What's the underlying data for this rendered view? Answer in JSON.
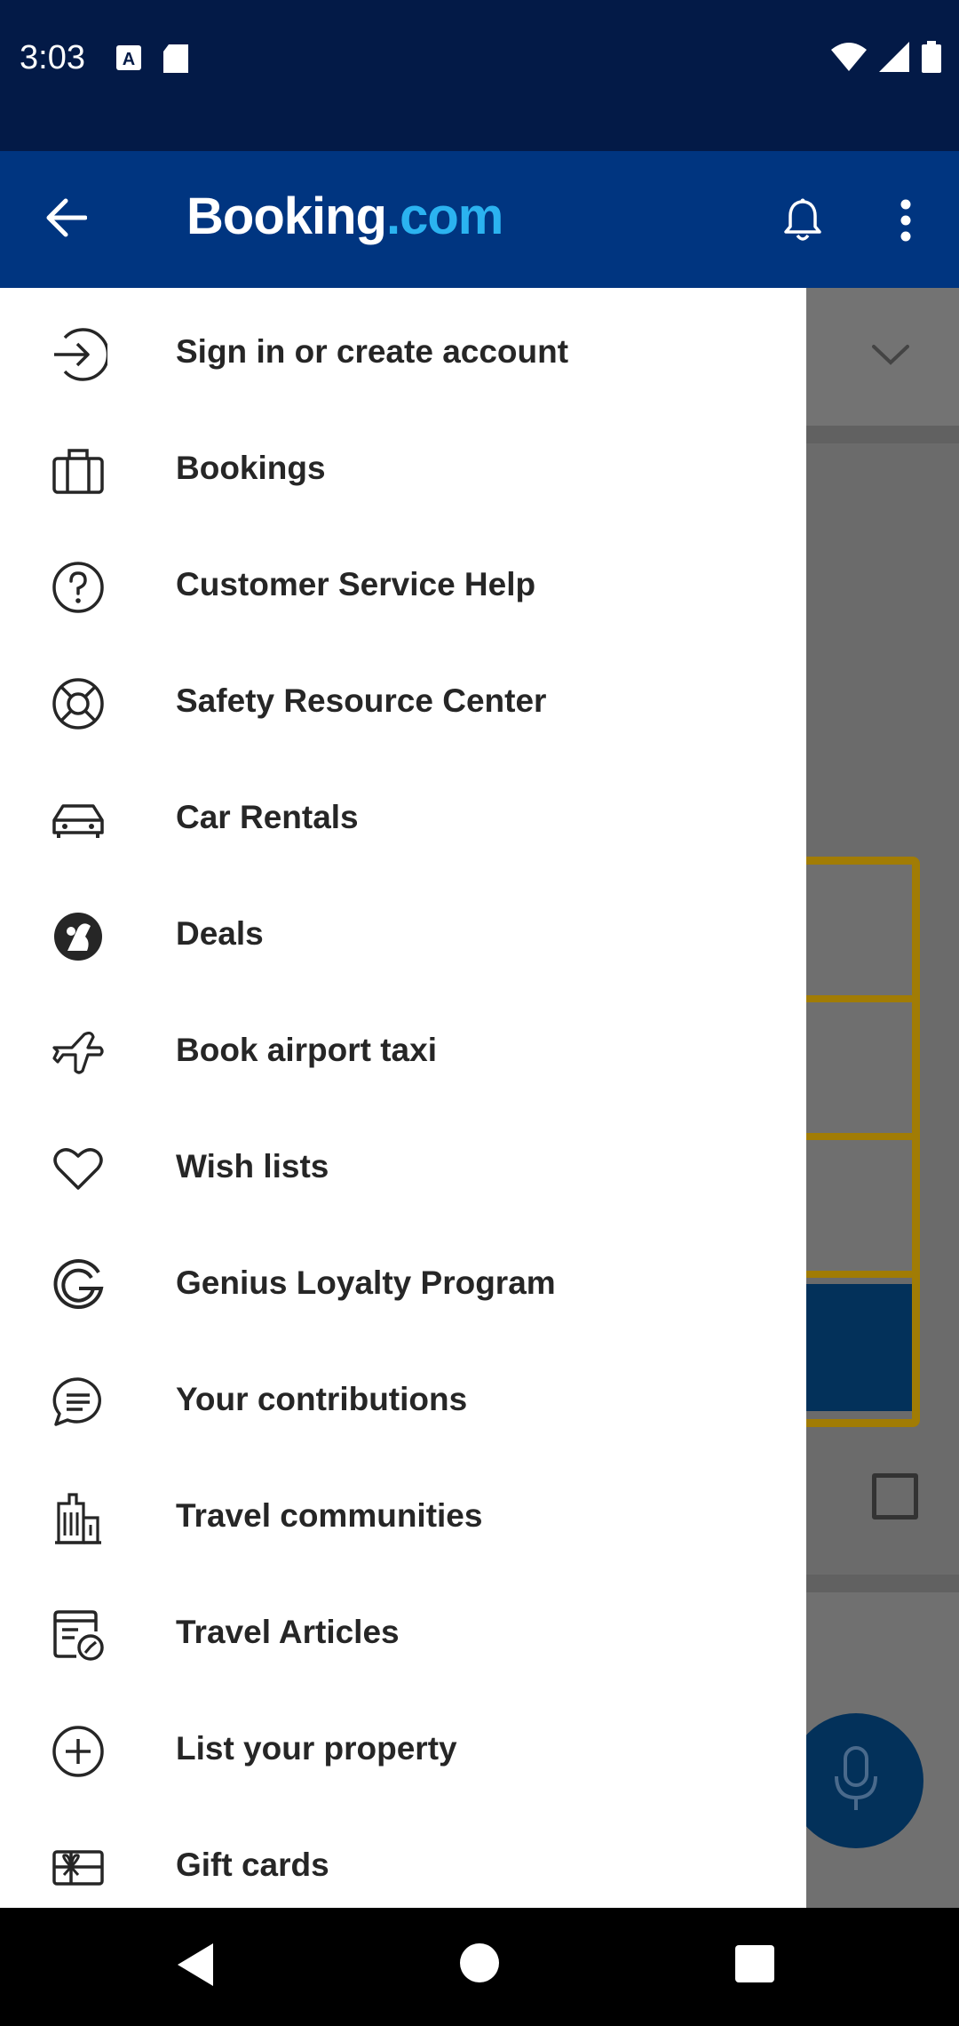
{
  "status_bar": {
    "time": "3:03",
    "icons": [
      "font-icon",
      "sd-card-icon",
      "wifi-icon",
      "signal-icon",
      "battery-icon"
    ]
  },
  "app_bar": {
    "brand_part1": "Booking",
    "brand_part2": ".com",
    "brand_color": "#2bb3f0",
    "background": "#003580",
    "icons": [
      "back-arrow-icon",
      "bell-icon",
      "more-vert-icon"
    ]
  },
  "menu": {
    "items": [
      {
        "label": "Sign in or create account",
        "icon": "sign-in-icon"
      },
      {
        "label": "Bookings",
        "icon": "briefcase-icon"
      },
      {
        "label": "Customer Service Help",
        "icon": "question-circle-icon"
      },
      {
        "label": "Safety Resource Center",
        "icon": "lifebuoy-icon"
      },
      {
        "label": "Car Rentals",
        "icon": "car-icon"
      },
      {
        "label": "Deals",
        "icon": "deals-icon"
      },
      {
        "label": "Book airport taxi",
        "icon": "airplane-icon"
      },
      {
        "label": "Wish lists",
        "icon": "heart-icon"
      },
      {
        "label": "Genius Loyalty Program",
        "icon": "genius-g-icon"
      },
      {
        "label": "Your contributions",
        "icon": "chat-bubble-icon"
      },
      {
        "label": "Travel communities",
        "icon": "city-building-icon"
      },
      {
        "label": "Travel Articles",
        "icon": "article-icon"
      },
      {
        "label": "List your property",
        "icon": "plus-circle-icon"
      },
      {
        "label": "Gift cards",
        "icon": "gift-card-icon"
      }
    ]
  },
  "navigation_bar": {
    "icons": [
      "nav-back-icon",
      "nav-home-icon",
      "nav-recents-icon"
    ]
  }
}
